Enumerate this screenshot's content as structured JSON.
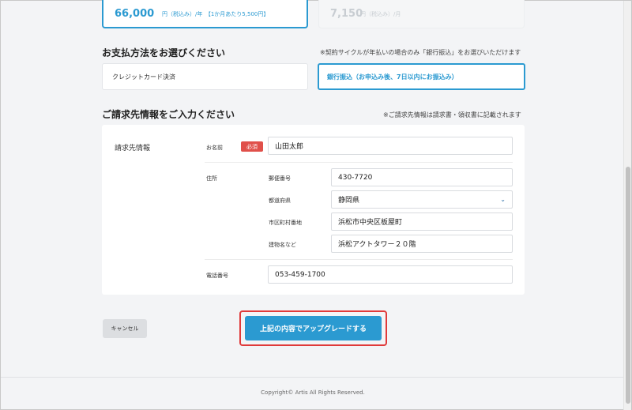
{
  "plans": {
    "selected": {
      "price": "66,000",
      "suffix": "円（税込み）/年　【1か月あたり5,500円】"
    },
    "other": {
      "price": "7,150",
      "suffix": "円（税込み）/月"
    }
  },
  "payment": {
    "title": "お支払方法をお選びください",
    "note": "※契約サイクルが年払いの場合のみ「銀行振込」をお選びいただけます",
    "options": [
      {
        "label": "クレジットカード決済",
        "selected": false
      },
      {
        "label": "銀行振込（お申込み後、7日以内にお振込み）",
        "selected": true
      }
    ]
  },
  "billing": {
    "title": "ご請求先情報をご入力ください",
    "note": "※ご請求先情報は請求書・領収書に記載されます",
    "section_label": "請求先情報",
    "name": {
      "label": "お名前",
      "required": "必須",
      "value": "山田太郎"
    },
    "address": {
      "label": "住所",
      "postal": {
        "label": "郵便番号",
        "value": "430-7720"
      },
      "prefecture": {
        "label": "都道府県",
        "value": "静岡県"
      },
      "city": {
        "label": "市区町村番地",
        "value": "浜松市中央区板屋町"
      },
      "building": {
        "label": "建物名など",
        "value": "浜松アクトタワー２０階"
      }
    },
    "phone": {
      "label": "電話番号",
      "value": "053-459-1700"
    }
  },
  "actions": {
    "cancel": "キャンセル",
    "upgrade": "上記の内容でアップグレードする"
  },
  "footer": "Copyright© Artis All Rights Reserved.",
  "colors": {
    "accent": "#2b9ad1",
    "required": "#e0504a",
    "highlight": "#e03a3a"
  }
}
